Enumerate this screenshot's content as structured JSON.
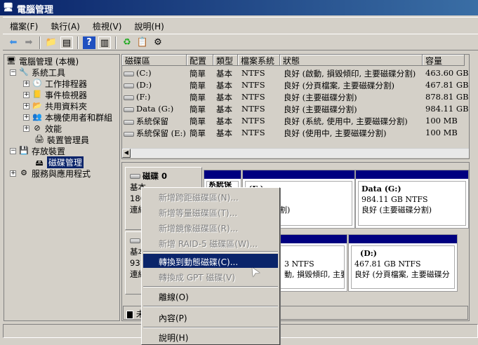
{
  "window": {
    "title": "電腦管理"
  },
  "menu": [
    "檔案(F)",
    "執行(A)",
    "檢視(V)",
    "說明(H)"
  ],
  "tree": {
    "root": "電腦管理 (本機)",
    "system_tools": "系統工具",
    "task_scheduler": "工作排程器",
    "event_viewer": "事件檢視器",
    "shared_folders": "共用資料夾",
    "local_users": "本機使用者和群組",
    "performance": "效能",
    "device_manager": "裝置管理員",
    "storage": "存放裝置",
    "disk_management": "磁碟管理",
    "services": "服務與應用程式"
  },
  "table": {
    "headers": [
      "磁碟區",
      "配置",
      "類型",
      "檔案系統",
      "狀態",
      "容量"
    ],
    "rows": [
      [
        "(C:)",
        "簡單",
        "基本",
        "NTFS",
        "良好 (啟動, 損毀傾印, 主要磁碟分割)",
        "463.60 GB"
      ],
      [
        "(D:)",
        "簡單",
        "基本",
        "NTFS",
        "良好 (分頁檔案, 主要磁碟分割)",
        "467.81 GB"
      ],
      [
        "(F:)",
        "簡單",
        "基本",
        "NTFS",
        "良好 (主要磁碟分割)",
        "878.81 GB"
      ],
      [
        "Data (G:)",
        "簡單",
        "基本",
        "NTFS",
        "良好 (主要磁碟分割)",
        "984.11 GB"
      ],
      [
        "系統保留",
        "簡單",
        "基本",
        "NTFS",
        "良好 (系統, 使用中, 主要磁碟分割)",
        "100 MB"
      ],
      [
        "系統保留 (E:)",
        "簡單",
        "基本",
        "NTFS",
        "良好 (使用中, 主要磁碟分割)",
        "100 MB"
      ]
    ]
  },
  "disks": [
    {
      "name": "磁碟 0",
      "type": "基本",
      "size": "186",
      "status": "連線",
      "partitions": [
        {
          "name": "系統保",
          "l1": "",
          "l2": ""
        },
        {
          "name": "(F:)",
          "l1": "3 NTFS",
          "l2": "要磁碟分割)"
        },
        {
          "name": "Data  (G:)",
          "l1": "984.11 GB NTFS",
          "l2": "良好 (主要磁碟分割)"
        }
      ]
    },
    {
      "name": "",
      "type": "基本",
      "size": "931",
      "status": "連線",
      "partitions": [
        {
          "name": "",
          "l1": "3 NTFS",
          "l2": "動, 損毀傾印, 主要"
        },
        {
          "name": "(D:)",
          "l1": "467.81 GB NTFS",
          "l2": "良好 (分頁檔案, 主要磁碟分"
        }
      ]
    }
  ],
  "legend": "未",
  "context_menu": [
    {
      "label": "新增跨距磁碟區(N)...",
      "enabled": false
    },
    {
      "label": "新增等量磁碟區(T)...",
      "enabled": false
    },
    {
      "label": "新增鏡像磁碟區(R)...",
      "enabled": false
    },
    {
      "label": "新增 RAID-5 磁碟區(W)...",
      "enabled": false
    },
    {
      "label": "轉換到動態磁碟(C)...",
      "enabled": true
    },
    {
      "label": "轉換成 GPT 磁碟(V)",
      "enabled": false
    },
    {
      "label": "離線(O)",
      "enabled": true
    },
    {
      "label": "內容(P)",
      "enabled": true
    },
    {
      "label": "說明(H)",
      "enabled": true
    }
  ]
}
